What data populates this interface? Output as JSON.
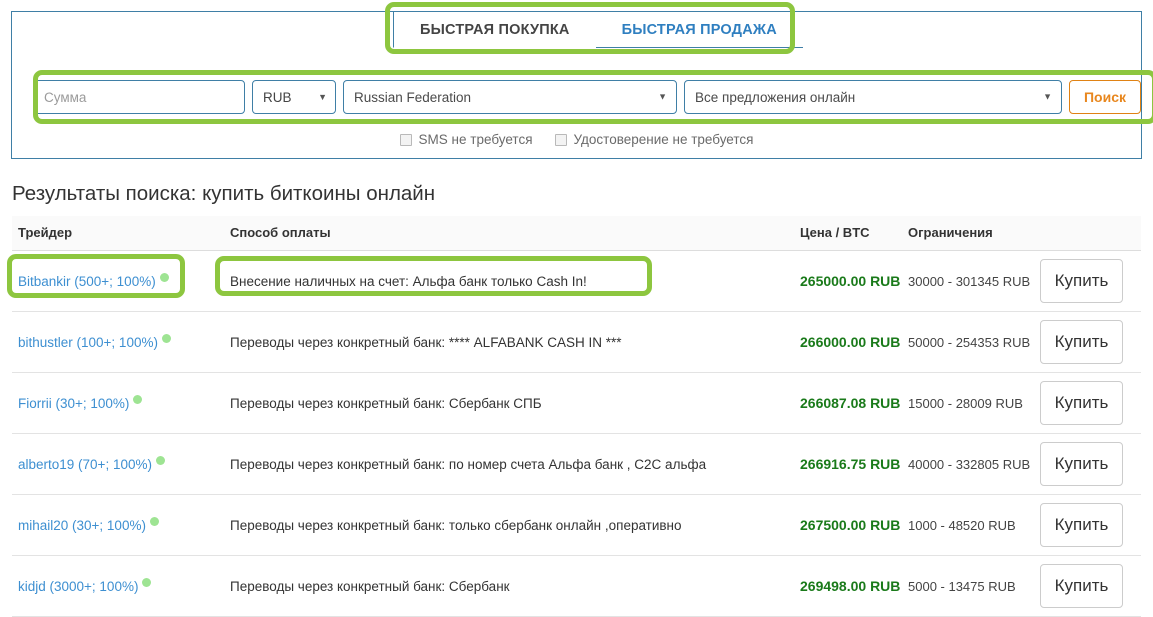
{
  "tabs": [
    {
      "label": "БЫСТРАЯ ПОКУПКА",
      "active": true
    },
    {
      "label": "БЫСТРАЯ ПРОДАЖА",
      "active": false
    }
  ],
  "search_form": {
    "amount_placeholder": "Сумма",
    "amount_value": "",
    "currency_value": "RUB",
    "country_value": "Russian Federation",
    "offers_value": "Все предложения онлайн",
    "search_button": "Поиск",
    "caret_glyph": "▼",
    "checkboxes": [
      {
        "label": "SMS не требуется",
        "checked": false
      },
      {
        "label": "Удостоверение не требуется",
        "checked": false
      }
    ]
  },
  "results": {
    "title": "Результаты поиска: купить биткоины онлайн",
    "columns": [
      "Трейдер",
      "Способ оплаты",
      "Цена / BTC",
      "Ограничения",
      ""
    ],
    "rows": [
      {
        "trader": "Bitbankir (500+; 100%)",
        "method": "Внесение наличных на счет: Альфа банк только Cash In!",
        "price": "265000.00 RUB",
        "limits": "30000 - 301345 RUB",
        "action": "Купить"
      },
      {
        "trader": "bithustler (100+; 100%)",
        "method": "Переводы через конкретный банк: **** ALFABANK CASH IN ***",
        "price": "266000.00 RUB",
        "limits": "50000 - 254353 RUB",
        "action": "Купить"
      },
      {
        "trader": "Fiorrii (30+; 100%)",
        "method": "Переводы через конкретный банк: Сбербанк СПБ",
        "price": "266087.08 RUB",
        "limits": "15000 - 28009 RUB",
        "action": "Купить"
      },
      {
        "trader": "alberto19 (70+; 100%)",
        "method": "Переводы через конкретный банк: по номер счета Альфа банк , C2C альфа",
        "price": "266916.75 RUB",
        "limits": "40000 - 332805 RUB",
        "action": "Купить"
      },
      {
        "trader": "mihail20 (30+; 100%)",
        "method": "Переводы через конкретный банк: только сбербанк онлайн ,оперативно",
        "price": "267500.00 RUB",
        "limits": "1000 - 48520 RUB",
        "action": "Купить"
      },
      {
        "trader": "kidjd (3000+; 100%)",
        "method": "Переводы через конкретный банк: Сбербанк",
        "price": "269498.00 RUB",
        "limits": "5000 - 13475 RUB",
        "action": "Купить"
      }
    ]
  },
  "colors": {
    "highlight_green": "#8dc63f",
    "panel_border_blue": "#3f7fa6",
    "price_green": "#1a7a1a",
    "link_blue": "#3d8fd1",
    "search_orange": "#e8871e",
    "online_dot": "#9ee493"
  }
}
